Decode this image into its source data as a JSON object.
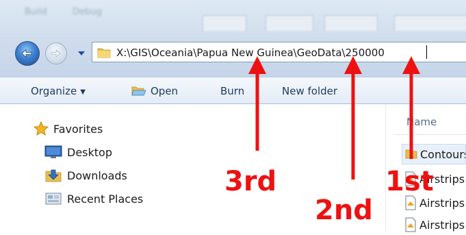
{
  "window": {
    "menu_items": [
      "Build",
      "Debug"
    ]
  },
  "address_bar": {
    "path": "X:\\GIS\\Oceania\\Papua New Guinea\\GeoData\\250000"
  },
  "toolbar": {
    "organize_label": "Organize",
    "open_label": "Open",
    "burn_label": "Burn",
    "new_folder_label": "New folder"
  },
  "sidebar": {
    "favorites_label": "Favorites",
    "items": [
      {
        "label": "Desktop",
        "icon": "desktop-icon"
      },
      {
        "label": "Downloads",
        "icon": "downloads-icon"
      },
      {
        "label": "Recent Places",
        "icon": "recent-places-icon"
      }
    ]
  },
  "file_list": {
    "column_header": "Name",
    "rows": [
      {
        "name": "Contours",
        "icon": "folder-icon",
        "selected": true
      },
      {
        "name": "Airstrips",
        "icon": "document-icon"
      },
      {
        "name": "Airstrips",
        "icon": "document-icon"
      },
      {
        "name": "Airstrips",
        "icon": "document-icon"
      }
    ]
  },
  "annotations": {
    "labels": [
      "3rd",
      "2nd",
      "1st"
    ],
    "color": "#ee1111"
  }
}
